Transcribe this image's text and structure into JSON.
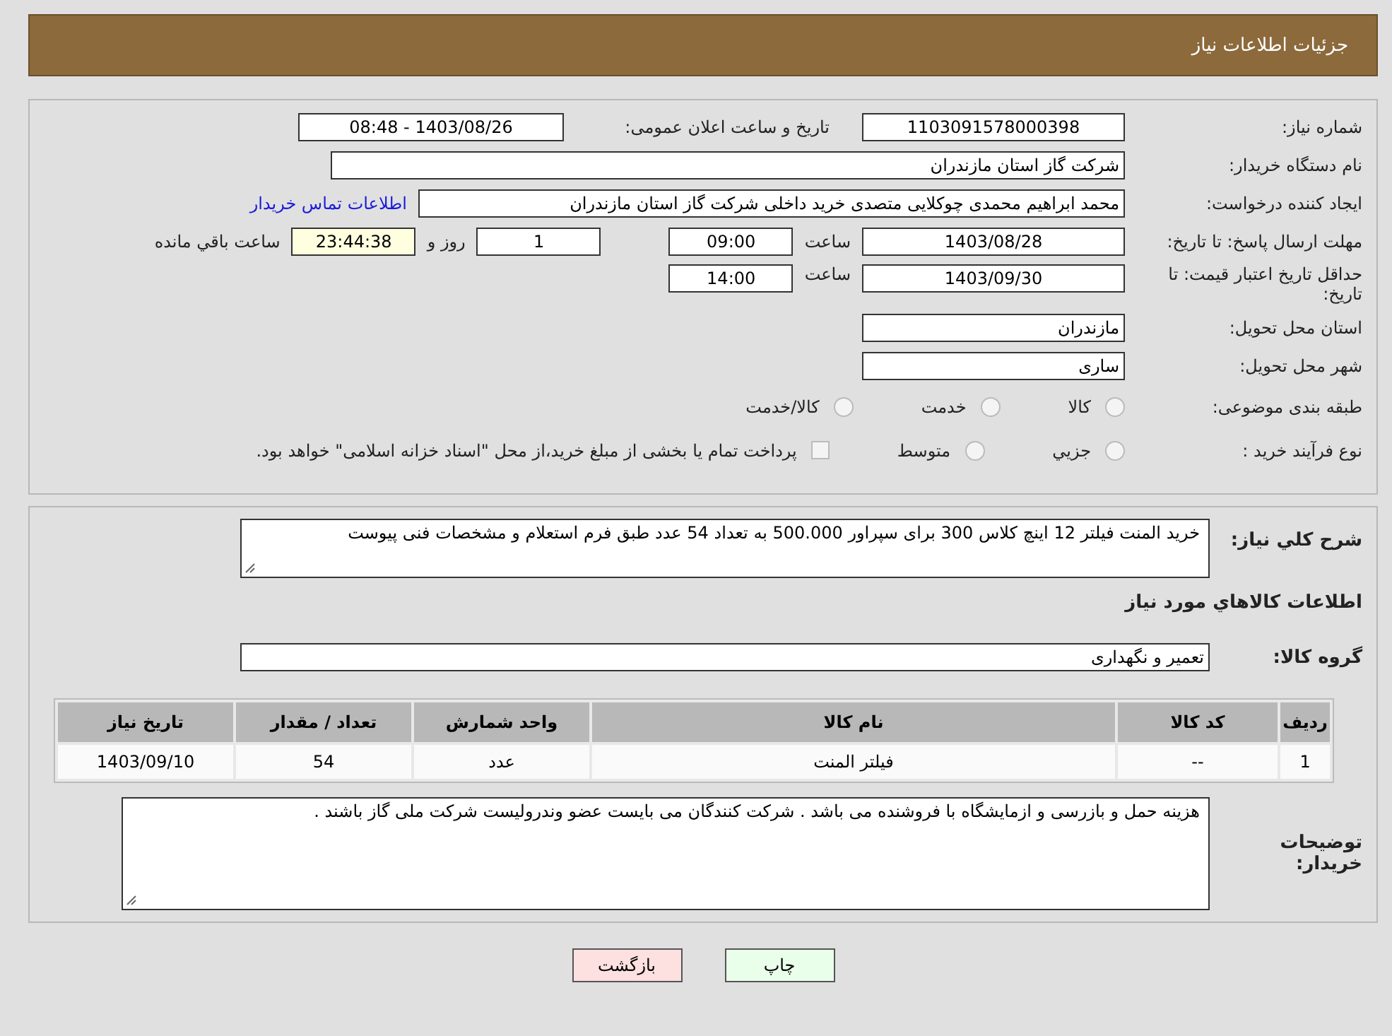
{
  "header": {
    "title": "جزئیات اطلاعات نیاز"
  },
  "fields": {
    "need_number": {
      "label": "شماره نیاز:",
      "value": "1103091578000398"
    },
    "announce": {
      "label": "تاریخ و ساعت اعلان عمومی:",
      "value": "1403/08/26 - 08:48"
    },
    "buyer_org": {
      "label": "نام دستگاه خریدار:",
      "value": "شرکت گاز استان مازندران"
    },
    "creator": {
      "label": "ایجاد کننده درخواست:",
      "value": "محمد ابراهیم محمدی چوکلایی متصدی خرید داخلی شرکت گاز استان مازندران",
      "link": "اطلاعات تماس خریدار"
    },
    "deadline": {
      "label": "مهلت ارسال پاسخ: تا تاریخ:",
      "date": "1403/08/28",
      "time_label": "ساعت",
      "time": "09:00",
      "days": "1",
      "days_label": "روز و",
      "remaining": "23:44:38",
      "remaining_label": "ساعت باقي مانده"
    },
    "validity": {
      "label": "حداقل تاریخ اعتبار قیمت: تا تاریخ:",
      "date": "1403/09/30",
      "time_label": "ساعت",
      "time": "14:00"
    },
    "province": {
      "label": "استان محل تحویل:",
      "value": "مازندران"
    },
    "city": {
      "label": "شهر محل تحویل:",
      "value": "ساری"
    },
    "category": {
      "label": "طبقه بندی موضوعی:",
      "options": [
        {
          "label": "کالا",
          "selected": false
        },
        {
          "label": "خدمت",
          "selected": false
        },
        {
          "label": "کالا/خدمت",
          "selected": false
        }
      ]
    },
    "process": {
      "label": "نوع فرآیند خرید :",
      "options": [
        {
          "label": "جزيي",
          "selected": false
        },
        {
          "label": "متوسط",
          "selected": false
        }
      ],
      "payment": {
        "label": "پرداخت تمام یا بخشی از مبلغ خرید،از محل \"اسناد خزانه اسلامی\" خواهد بود.",
        "checked": false
      }
    }
  },
  "description": {
    "label": "شرح کلي نياز:",
    "value": "خرید المنت فیلتر 12 اینچ کلاس 300 برای سپراور 500.000 به تعداد 54 عدد  طبق  فرم استعلام و مشخصات فنی پیوست"
  },
  "goods_title": "اطلاعات کالاهاي مورد نياز",
  "goods_group": {
    "label": "گروه کالا:",
    "value": "تعمیر و نگهداری"
  },
  "table": {
    "columns": [
      "رديف",
      "کد کالا",
      "نام کالا",
      "واحد شمارش",
      "تعداد / مقدار",
      "تاريخ نياز"
    ],
    "rows": [
      [
        "1",
        "--",
        "فیلتر المنت",
        "عدد",
        "54",
        "1403/09/10"
      ]
    ]
  },
  "buyer_notes": {
    "label": "توضیحات خریدار:",
    "value": "هزینه حمل و بازرسی و ازمایشگاه با فروشنده می باشد . شرکت کنندگان می بایست عضو وندرولیست شرکت ملی گاز باشند ."
  },
  "buttons": [
    {
      "label": "چاپ",
      "kind": "print"
    },
    {
      "label": "بازگشت",
      "kind": "back"
    }
  ]
}
